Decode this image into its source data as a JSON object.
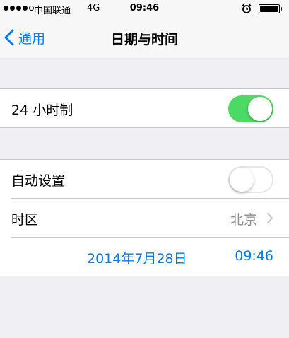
{
  "status_bar": {
    "carrier": "中国联通",
    "network": "4G",
    "time": "09:46",
    "signal_bars": 4,
    "battery_level": 0.95
  },
  "nav": {
    "back_label": "通用",
    "title": "日期与时间"
  },
  "settings": {
    "hour24": {
      "label": "24 小时制",
      "enabled": true
    },
    "auto_set": {
      "label": "自动设置",
      "enabled": false
    },
    "timezone": {
      "label": "时区",
      "value": "北京"
    },
    "datetime": {
      "date": "2014年7月28日",
      "time": "09:46"
    }
  },
  "colors": {
    "accent": "#007aff",
    "toggle_on": "#4cd964",
    "background": "#efeff4",
    "secondary_text": "#8e8e93"
  },
  "icons": {
    "back": "chevron-left-icon",
    "disclosure": "chevron-right-icon",
    "alarm": "alarm-clock-icon"
  }
}
